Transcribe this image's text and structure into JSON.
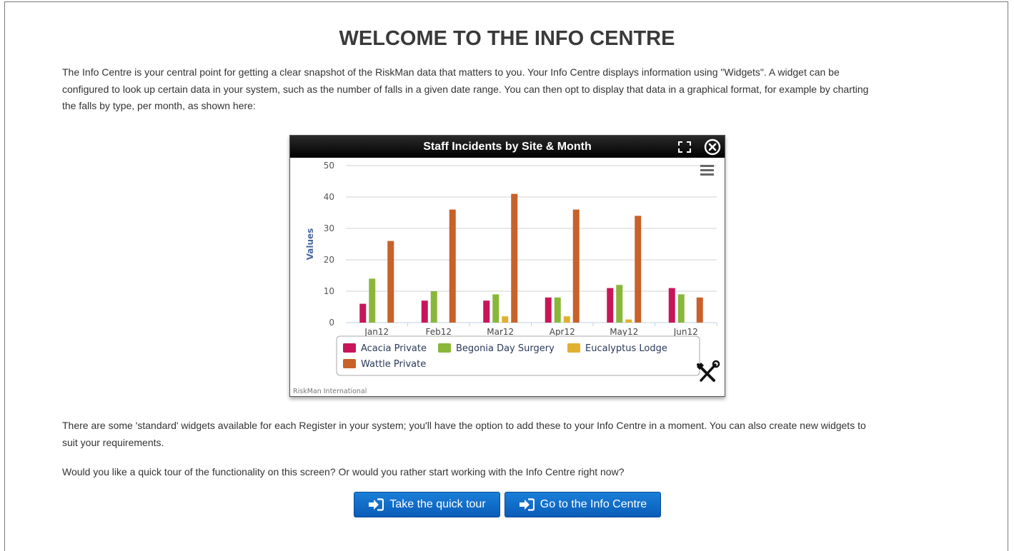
{
  "page": {
    "title": "WELCOME TO THE INFO CENTRE",
    "intro_lines": [
      "The Info Centre is your central point for getting a clear snapshot of the RiskMan data that matters to you. Your Info Centre displays information using \"Widgets\". A widget can be",
      "configured to look up certain data in your system, such as the number of falls in a given date range. You can then opt to display that data in a graphical format, for example by charting",
      "the falls by type, per month, as shown here:"
    ],
    "standard_lines": [
      "There are some 'standard' widgets available for each Register in your system; you'll have the option to add these to your Info Centre in a moment. You can also create new widgets to",
      "suit your requirements."
    ],
    "question": "Would you like a quick tour of the functionality on this screen? Or would you rather start working with the Info Centre right now?"
  },
  "widget": {
    "title": "Staff Incidents by Site & Month",
    "icons": [
      "expand-icon",
      "close-icon",
      "menu-icon",
      "tools-icon"
    ],
    "credit": "RiskMan International"
  },
  "chart_data": {
    "type": "bar",
    "title": "Staff Incidents by Site & Month",
    "ylabel": "Values",
    "xlabel": "",
    "ylim": [
      0,
      50
    ],
    "yticks": [
      0,
      10,
      20,
      30,
      40,
      50
    ],
    "grid": true,
    "legend_position": "bottom",
    "categories": [
      "Jan12",
      "Feb12",
      "Mar12",
      "Apr12",
      "May12",
      "Jun12"
    ],
    "series": [
      {
        "name": "Acacia Private",
        "color": "#c8155a",
        "values": [
          6,
          7,
          7,
          8,
          11,
          11
        ]
      },
      {
        "name": "Begonia Day Surgery",
        "color": "#8ab73a",
        "values": [
          14,
          10,
          9,
          8,
          12,
          9
        ]
      },
      {
        "name": "Eucalyptus Lodge",
        "color": "#e0b030",
        "values": [
          0,
          0,
          2,
          2,
          1,
          0
        ]
      },
      {
        "name": "Wattle Private",
        "color": "#c8612a",
        "values": [
          26,
          36,
          41,
          36,
          34,
          8
        ]
      }
    ]
  },
  "buttons": {
    "tour_label": "Take the quick tour",
    "info_label": "Go to the Info Centre",
    "icon": "sign-in-icon"
  }
}
